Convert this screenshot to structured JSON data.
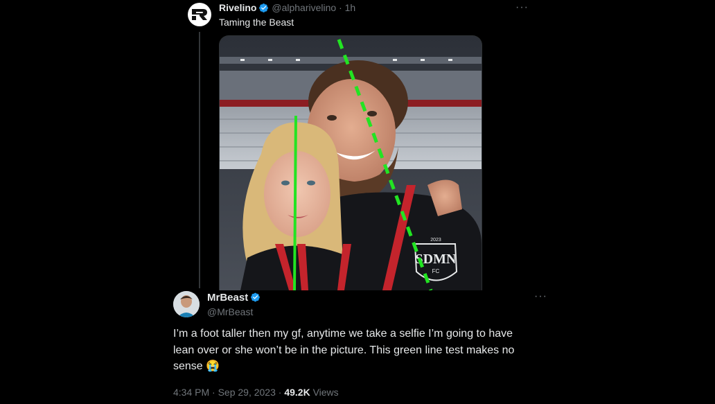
{
  "quoted_tweet": {
    "author_name": "Rivelino",
    "handle": "@alpharivelino",
    "time": "· 1h",
    "text": "Taming the Beast",
    "more_label": "···"
  },
  "tweet": {
    "author_name": "MrBeast",
    "handle": "@MrBeast",
    "text": "I’m a foot taller then my gf, anytime we take a selfie I’m going to have lean over or she won’t be in the picture. This green line test makes no sense 😭",
    "timestamp": "4:34 PM · Sep 29, 2023 · ",
    "views_count": "49.2K",
    "views_label": " Views",
    "more_label": "···"
  },
  "media": {
    "lanyard_text": "SDMN",
    "lanyard_sub": "FC",
    "year_text": "2023",
    "green_line_color": "#22e422"
  },
  "colors": {
    "background": "#000000",
    "verified": "#1d9bf0",
    "muted": "#71767b"
  },
  "icons": [
    "verified-badge-icon",
    "more-options-icon",
    "rivelino-logo-icon"
  ]
}
